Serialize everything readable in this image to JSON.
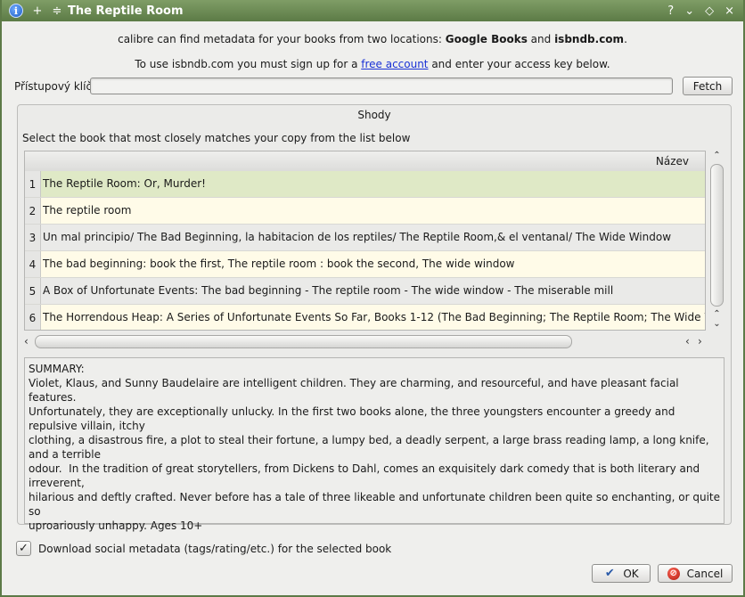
{
  "window": {
    "title": "The Reptile Room",
    "buttons": {
      "help": "?",
      "minimize": "⌄",
      "maximize": "◇",
      "close": "×",
      "pin": "+",
      "shade": "≑"
    }
  },
  "info": {
    "line1_pre": "calibre can find metadata for your books from two locations: ",
    "line1_src1": "Google Books",
    "line1_and": " and ",
    "line1_src2": "isbndb.com",
    "line1_post": ".",
    "line2_pre": "To use isbndb.com you must sign up for a ",
    "line2_link": "free account",
    "line2_post": " and enter your access key below."
  },
  "access_key": {
    "label": "Přístupový klíč",
    "value": "",
    "fetch_label": "Fetch"
  },
  "matches": {
    "group_title": "Shody",
    "instruction": "Select the book that most closely matches your copy from the list below",
    "column_header": "Název",
    "rows": [
      {
        "num": "1",
        "title": "The Reptile Room: Or, Murder!"
      },
      {
        "num": "2",
        "title": "The reptile room"
      },
      {
        "num": "3",
        "title": "Un mal principio/ The Bad Beginning, la habitacion de los reptiles/ The Reptile Room,& el ventanal/ The Wide Window"
      },
      {
        "num": "4",
        "title": "The bad beginning: book the first, The reptile room : book the second, The wide window"
      },
      {
        "num": "5",
        "title": "A Box of Unfortunate Events: The bad beginning - The reptile room - The wide window - The miserable mill"
      },
      {
        "num": "6",
        "title": "The Horrendous Heap: A Series of Unfortunate Events So Far, Books 1-12 (The Bad Beginning; The Reptile Room; The Wide Window; The"
      }
    ]
  },
  "summary": "SUMMARY:\nViolet, Klaus, and Sunny Baudelaire are intelligent children. They are charming, and resourceful, and have pleasant facial features.\nUnfortunately, they are exceptionally unlucky. In the first two books alone, the three youngsters encounter a greedy and repulsive villain, itchy\nclothing, a disastrous fire, a plot to steal their fortune, a lumpy bed, a deadly serpent, a large brass reading lamp, a long knife, and a terrible\nodour.  In the tradition of great storytellers, from Dickens to Dahl, comes an exquisitely dark comedy that is both literary and irreverent,\nhilarious and deftly crafted. Never before has a tale of three likeable and unfortunate children been quite so enchanting, or quite so\nuproariously unhappy. Ages 10+",
  "social": {
    "label": "Download social metadata (tags/rating/etc.) for the selected book",
    "checked": true
  },
  "actions": {
    "ok_label": "OK",
    "cancel_label": "Cancel"
  },
  "colors": {
    "titlebar": "#5c7b46",
    "selected_row": "#dfe9c6",
    "link": "#1a32d6"
  }
}
